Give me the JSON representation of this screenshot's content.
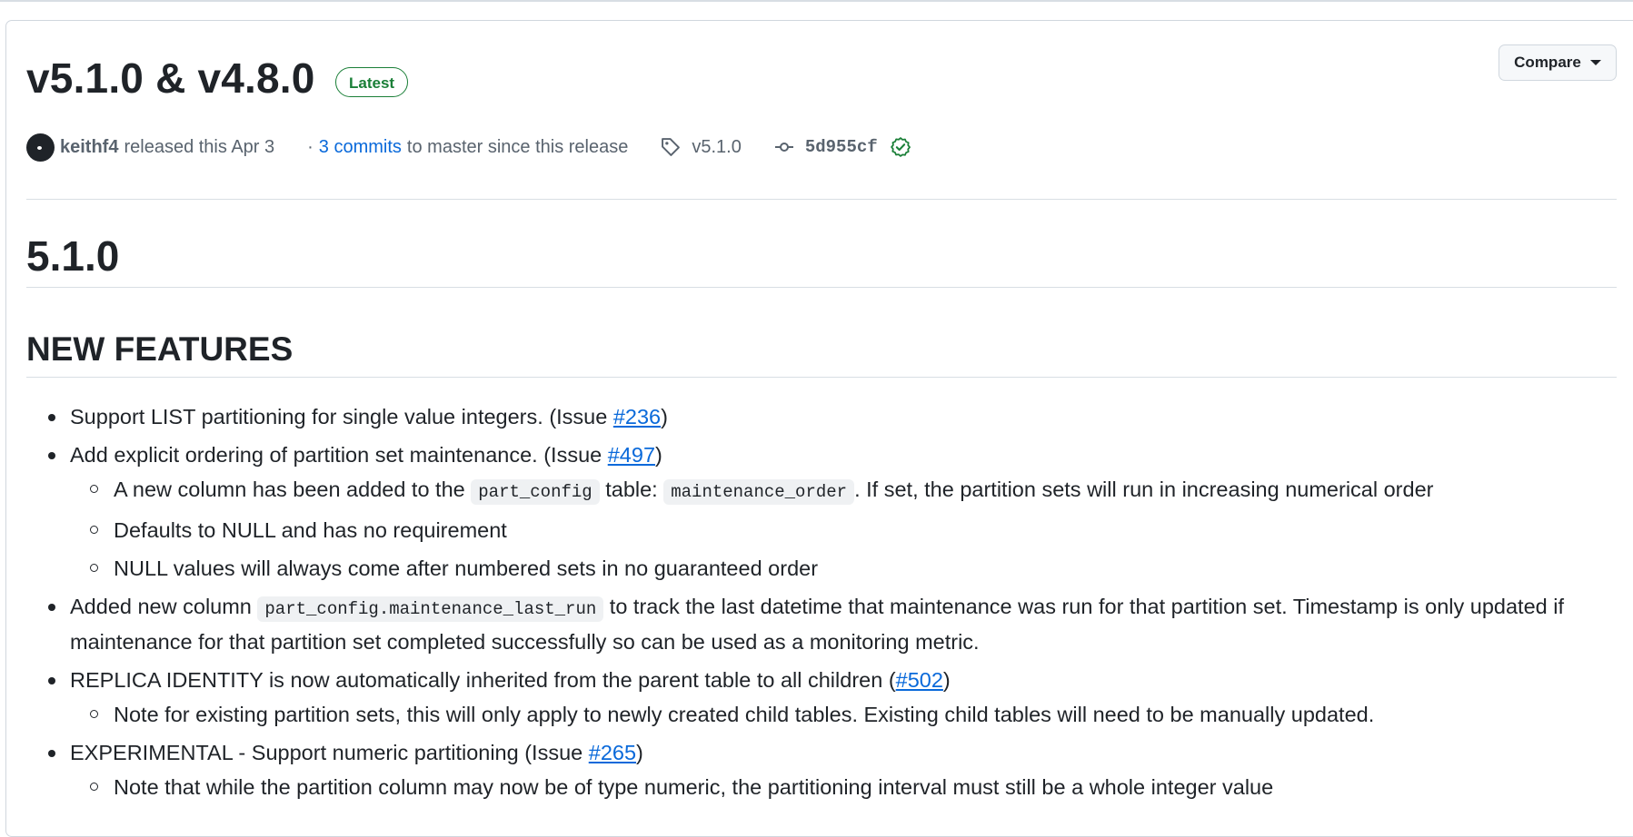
{
  "release": {
    "title": "v5.1.0 & v4.8.0",
    "badge": "Latest",
    "compare_label": "Compare"
  },
  "meta": {
    "author": "keithf4",
    "released_text": "released this Apr 3",
    "dot": "·",
    "commits_link": "3 commits",
    "commits_suffix": "to master since this release",
    "tag": "v5.1.0",
    "commit_sha": "5d955cf"
  },
  "body": {
    "version_heading": "5.1.0",
    "section_heading": "NEW FEATURES",
    "items": [
      {
        "text_before": "Support LIST partitioning for single value integers. (Issue ",
        "link": "#236",
        "text_after": ")"
      },
      {
        "text_before": "Add explicit ordering of partition set maintenance. (Issue ",
        "link": "#497",
        "text_after": ")",
        "sub": [
          {
            "t1": "A new column has been added to the ",
            "code1": "part_config",
            "t2": " table: ",
            "code2": "maintenance_order",
            "t3": ". If set, the partition sets will run in increasing numerical order"
          },
          {
            "text": "Defaults to NULL and has no requirement"
          },
          {
            "text": "NULL values will always come after numbered sets in no guaranteed order"
          }
        ]
      },
      {
        "text_before": "Added new column ",
        "code": "part_config.maintenance_last_run",
        "text_after": " to track the last datetime that maintenance was run for that partition set. Timestamp is only updated if maintenance for that partition set completed successfully so can be used as a monitoring metric."
      },
      {
        "text_before": "REPLICA IDENTITY is now automatically inherited from the parent table to all children (",
        "link": "#502",
        "text_after": ")",
        "sub": [
          {
            "text": "Note for existing partition sets, this will only apply to newly created child tables. Existing child tables will need to be manually updated."
          }
        ]
      },
      {
        "text_before": "EXPERIMENTAL - Support numeric partitioning (Issue ",
        "link": "#265",
        "text_after": ")",
        "sub": [
          {
            "text": "Note that while the partition column may now be of type numeric, the partitioning interval must still be a whole integer value"
          }
        ]
      }
    ]
  },
  "colors": {
    "accent_link": "#0969da",
    "badge_green": "#1a7f37",
    "muted_text": "#59636e"
  }
}
